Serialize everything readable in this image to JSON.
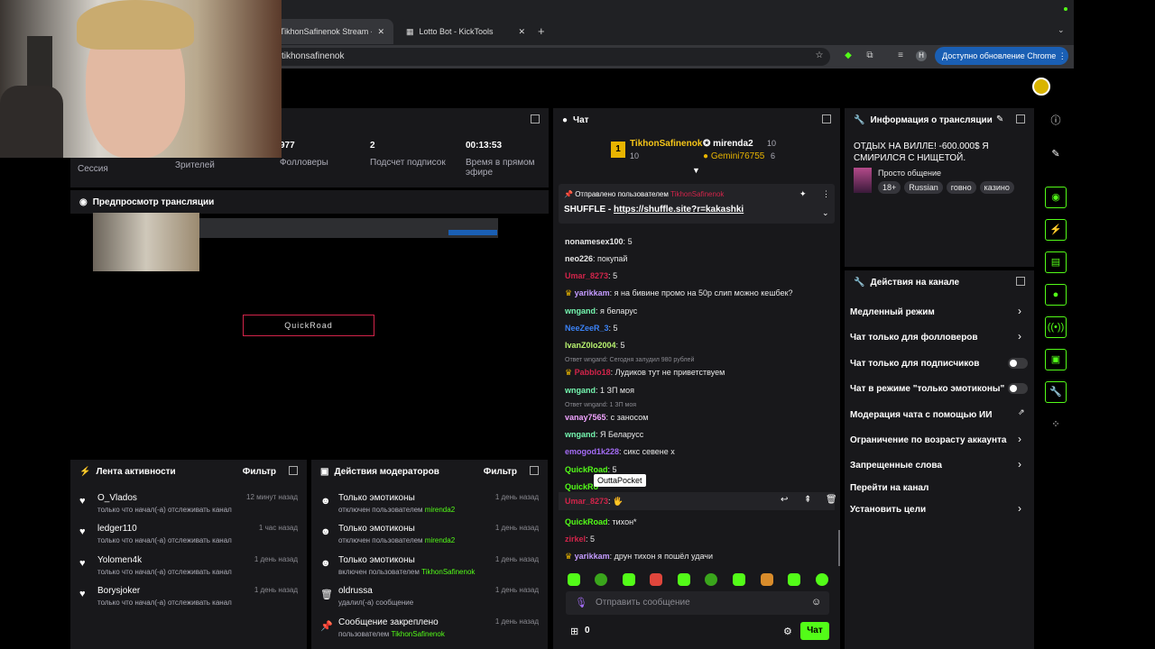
{
  "browser": {
    "tab1": "TikhonSafinenok Stream - Kic",
    "tab2": "Lotto Bot - KickTools",
    "new_tab": "+",
    "address": "tikhonsafinenok",
    "update_button": "Доступно обновление Chrome"
  },
  "stats": {
    "session_label": "Сессия",
    "viewers_label": "Зрителей",
    "followers_value": "977",
    "followers_label": "Фолловеры",
    "subs_value": "2",
    "subs_label": "Подсчет подписок",
    "uptime_value": "00:13:53",
    "uptime_label": "Время в прямом эфире"
  },
  "preview": {
    "title": "Предпросмотр трансляции",
    "overlay_label": "QuickRoad"
  },
  "activity": {
    "title": "Лента активности",
    "filter": "Фильтр",
    "items": [
      {
        "name": "O_Vlados",
        "sub": "только что начал(-а) отслеживать канал",
        "time": "12 минут назад"
      },
      {
        "name": "ledger110",
        "sub": "только что начал(-а) отслеживать канал",
        "time": "1 час назад"
      },
      {
        "name": "Yolomen4k",
        "sub": "только что начал(-а) отслеживать канал",
        "time": "1 день назад"
      },
      {
        "name": "Borysjoker",
        "sub": "только что начал(-а) отслеживать канал",
        "time": "1 день назад"
      }
    ]
  },
  "mod_actions": {
    "title": "Действия модераторов",
    "filter": "Фильтр",
    "items": [
      {
        "title": "Только эмотиконы",
        "sub": "отключен пользователем",
        "user": "mirenda2",
        "time": "1 день назад"
      },
      {
        "title": "Только эмотиконы",
        "sub": "отключен пользователем",
        "user": "mirenda2",
        "time": "1 день назад"
      },
      {
        "title": "Только эмотиконы",
        "sub": "включен пользователем",
        "user": "TikhonSafinenok",
        "time": "1 день назад"
      },
      {
        "title": "oldrussa",
        "sub": "удалил(-а) сообщение",
        "user": "",
        "time": "1 день назад"
      },
      {
        "title": "Сообщение закреплено",
        "sub": "пользователем",
        "user": "TikhonSafinenok",
        "time": "1 день назад"
      }
    ]
  },
  "chat": {
    "title": "Чат",
    "leader1": {
      "name": "TikhonSafinenok",
      "count": "10"
    },
    "leader2": {
      "name": "mirenda2",
      "count": "10"
    },
    "leader3": {
      "name": "Gemini76755",
      "count": "6"
    },
    "pinned_by": "Отправлено пользователем",
    "pinned_user": "TikhonSafinenok",
    "pinned_text": "SHUFFLE - ",
    "pinned_link": "https://shuffle.site?r=kakashki",
    "messages": [
      {
        "user": "nonamesex100",
        "color": "#e9e9e9",
        "text": "5"
      },
      {
        "user": "neo226",
        "color": "#e9e9e9",
        "text": "покупай"
      },
      {
        "user": "Umar_8273",
        "color": "#d2244a",
        "text": "5"
      },
      {
        "user": "yarikkam",
        "color": "#c49bff",
        "text": "я на бивине промо на 50р слип можно кешбек?"
      },
      {
        "user": "wngand",
        "color": "#75f7b0",
        "text": "я беларус"
      },
      {
        "user": "NeeZeeR_3",
        "color": "#3b82f6",
        "text": "5"
      },
      {
        "user": "IvanZ0lo2004",
        "color": "#b8f26f",
        "text": "5"
      },
      {
        "user": "Pabblo18",
        "color": "#d2244a",
        "text": "Лудиков тут не приветствуем",
        "reply": "Ответ wngand: Сегодня залудил 980 рублей"
      },
      {
        "user": "wngand",
        "color": "#75f7b0",
        "text": "1 ЗП моя"
      },
      {
        "user": "vanay7565",
        "color": "#f0a3ff",
        "text": "с заносом",
        "reply": "Ответ wngand: 1 ЗП моя"
      },
      {
        "user": "wngand",
        "color": "#75f7b0",
        "text": "Я Беларусс"
      },
      {
        "user": "emogod1k228",
        "color": "#a46cf5",
        "text": "сикс севене х"
      },
      {
        "user": "QuickRoad",
        "color": "#53fc18",
        "text": "5"
      },
      {
        "user": "QuickRo",
        "color": "#53fc18",
        "text": ""
      },
      {
        "user": "Umar_8273",
        "color": "#d2244a",
        "text": ""
      },
      {
        "user": "QuickRoad",
        "color": "#53fc18",
        "text": "тихон*"
      },
      {
        "user": "zirkel",
        "color": "#d2244a",
        "text": "5"
      },
      {
        "user": "yarikkam",
        "color": "#c49bff",
        "text": "друн тихон я пошёл удачи"
      }
    ],
    "tooltip": "OuttaPocket",
    "input_placeholder": "Отправить сообщение",
    "points": "0",
    "send": "Чат"
  },
  "stream_info": {
    "title": "Информация о трансляции",
    "stream_title": "ОТДЫХ НА ВИЛЛЕ! -600.000$ Я СМИРИЛСЯ С НИЩЕТОЙ.",
    "category": "Просто общение",
    "tags": [
      "18+",
      "Russian",
      "говно",
      "казино"
    ]
  },
  "channel_actions": {
    "title": "Действия на канале",
    "items": [
      {
        "label": "Медленный режим",
        "kind": "chevron"
      },
      {
        "label": "Чат только для фолловеров",
        "kind": "chevron"
      },
      {
        "label": "Чат только для подписчиков",
        "kind": "toggle"
      },
      {
        "label": "Чат в режиме \"только эмотиконы\"",
        "kind": "toggle"
      },
      {
        "label": "Модерация чата с помощью ИИ",
        "kind": "external"
      },
      {
        "label": "Ограничение по возрасту аккаунта",
        "kind": "chevron"
      },
      {
        "label": "Запрещенные слова",
        "kind": "chevron"
      },
      {
        "label": "Перейти на канал",
        "kind": "none"
      },
      {
        "label": "Установить цели",
        "kind": "chevron"
      }
    ]
  },
  "colors": {
    "accent": "#53fc18",
    "panel": "#18181b",
    "bg": "#000000"
  }
}
